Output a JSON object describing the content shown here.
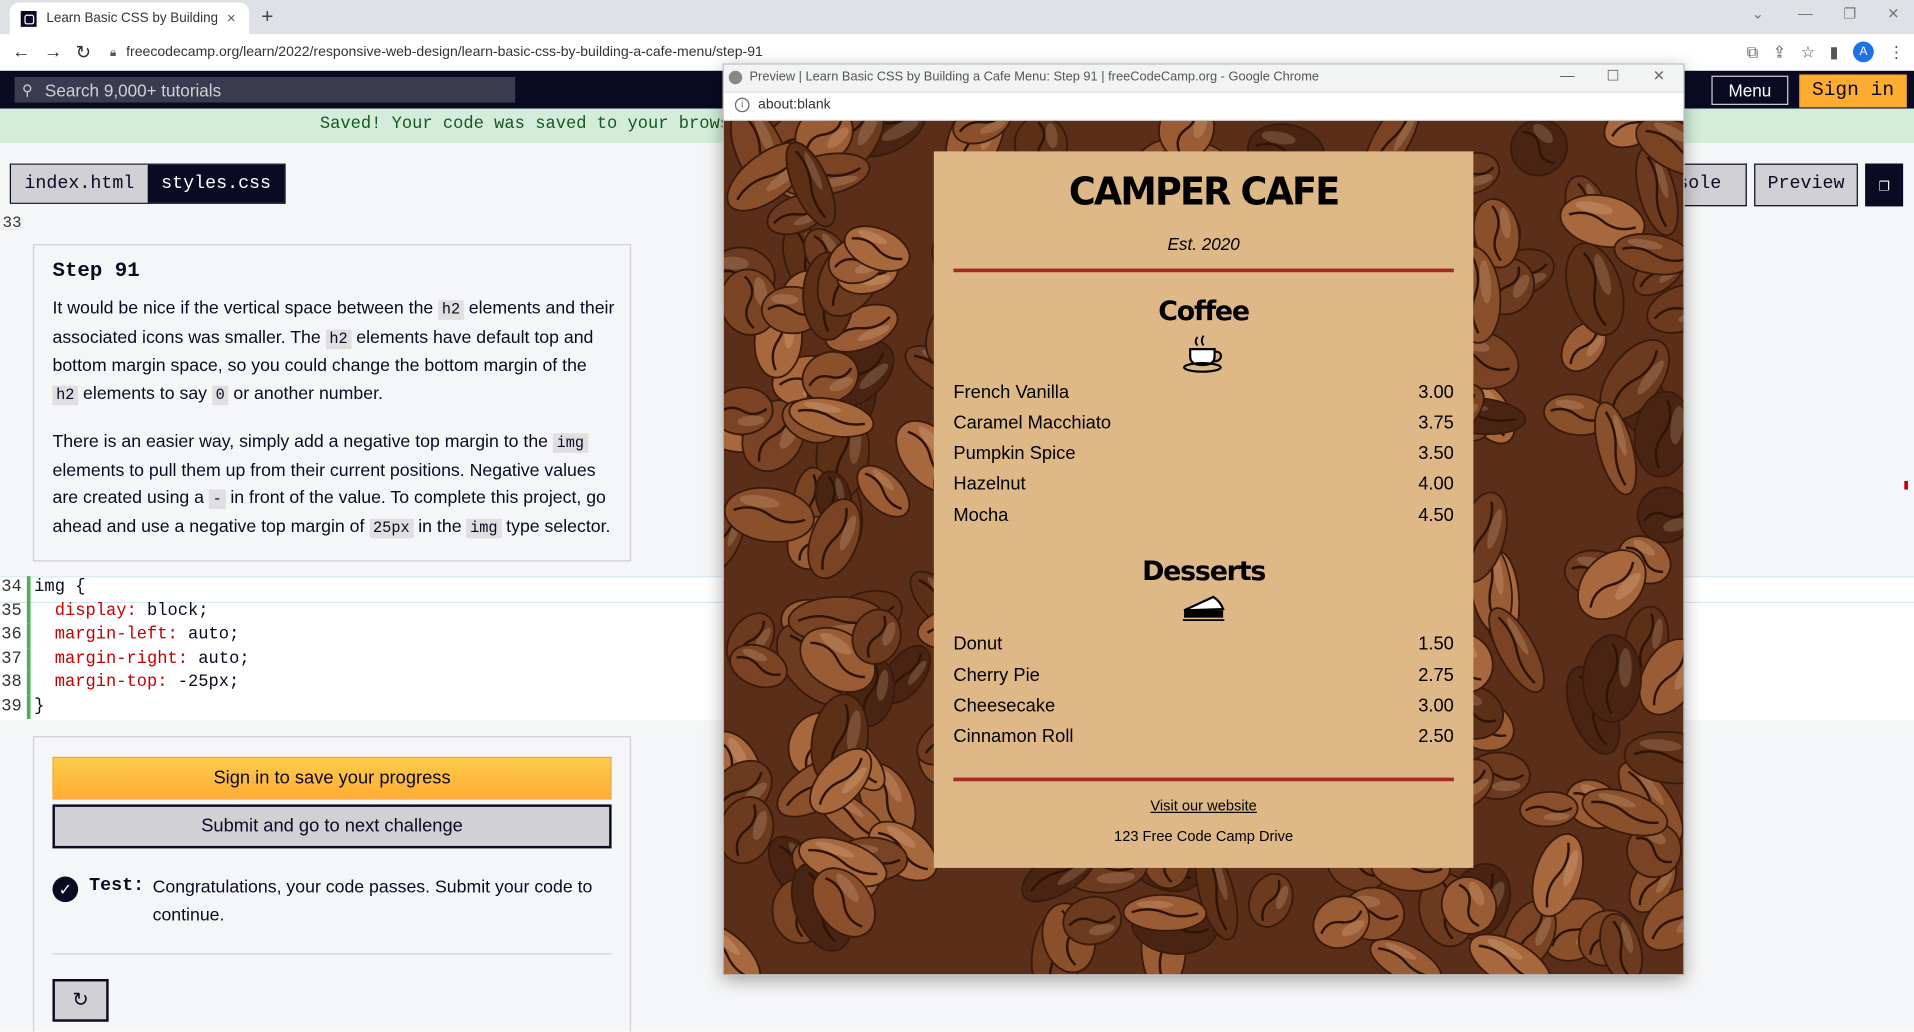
{
  "browser": {
    "tab_title": "Learn Basic CSS by Building a Cafe Menu",
    "tab_close": "×",
    "new_tab": "+",
    "url": "freecodecamp.org/learn/2022/responsive-web-design/learn-basic-css-by-building-a-cafe-menu/step-91",
    "avatar_initial": "A"
  },
  "fcc_nav": {
    "search_placeholder": "Search 9,000+ tutorials",
    "menu_label": "Menu",
    "signin_label": "Sign in"
  },
  "saved_banner": "Saved! Your code was saved to your browser's local storage.",
  "file_tabs": [
    "index.html",
    "styles.css"
  ],
  "right_tabs": {
    "console": "Console",
    "preview": "Preview"
  },
  "gutter_prev": "33",
  "step": {
    "title": "Step 91",
    "p1": [
      "It would be nice if the vertical space between the ",
      "h2",
      " elements and their associated icons was smaller. The ",
      "h2",
      " elements have default top and bottom margin space, so you could change the bottom margin of the ",
      "h2",
      " elements to say ",
      "0",
      " or another number."
    ],
    "p2": [
      "There is an easier way, simply add a negative top margin to the ",
      "img",
      " elements to pull them up from their current positions. Negative values are created using a ",
      "-",
      " in front of the value. To complete this project, go ahead and use a negative top margin of ",
      "25px",
      " in the ",
      "img",
      " type selector."
    ]
  },
  "code": {
    "lines": [
      {
        "n": "34",
        "sel": "img {"
      },
      {
        "n": "35",
        "prop": "display",
        "val": "block;"
      },
      {
        "n": "36",
        "prop": "margin-left",
        "val": "auto;"
      },
      {
        "n": "37",
        "prop": "margin-right",
        "val": "auto;"
      },
      {
        "n": "38",
        "prop": "margin-top",
        "val": "-25px;"
      },
      {
        "n": "39",
        "sel": "}"
      }
    ]
  },
  "actions": {
    "signin_save": "Sign in to save your progress",
    "submit": "Submit and go to next challenge",
    "test_label": "Test:",
    "test_text": "Congratulations, your code passes. Submit your code to continue.",
    "reset_icon": "refresh-icon"
  },
  "popup": {
    "window_title": "Preview | Learn Basic CSS by Building a Cafe Menu: Step 91 | freeCodeCamp.org - Google Chrome",
    "address": "about:blank",
    "cafe_name": "CAMPER CAFE",
    "established": "Est. 2020",
    "sections": [
      {
        "heading": "Coffee",
        "icon": "coffee-cup-icon",
        "items": [
          {
            "name": "French Vanilla",
            "price": "3.00"
          },
          {
            "name": "Caramel Macchiato",
            "price": "3.75"
          },
          {
            "name": "Pumpkin Spice",
            "price": "3.50"
          },
          {
            "name": "Hazelnut",
            "price": "4.00"
          },
          {
            "name": "Mocha",
            "price": "4.50"
          }
        ]
      },
      {
        "heading": "Desserts",
        "icon": "pie-slice-icon",
        "items": [
          {
            "name": "Donut",
            "price": "1.50"
          },
          {
            "name": "Cherry Pie",
            "price": "2.75"
          },
          {
            "name": "Cheesecake",
            "price": "3.00"
          },
          {
            "name": "Cinnamon Roll",
            "price": "2.50"
          }
        ]
      }
    ],
    "footer_link": "Visit our website",
    "footer_address": "123 Free Code Camp Drive"
  },
  "colors": {
    "fcc_dark": "#0a0a23",
    "signin_yellow": "#feac32",
    "card": "#deb887",
    "divider": "#a52a2a"
  }
}
